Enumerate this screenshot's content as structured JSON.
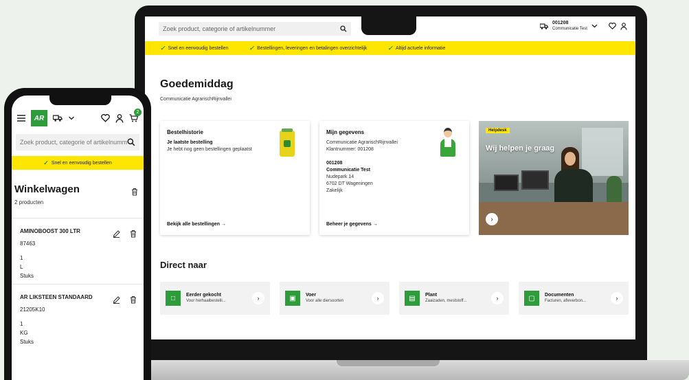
{
  "desktop": {
    "search_placeholder": "Zoek product, categorie of artikelnummer",
    "account": {
      "number": "001208",
      "name": "Communicatie Test"
    },
    "usps": [
      "Snel en eenvoudig bestellen",
      "Bestellingen, leveringen en betalingen overzichtelijk",
      "Altijd actuele informatie"
    ],
    "greeting": "Goedemiddag",
    "subtitle": "Communicatie AgrarischRijnvallei",
    "order_card": {
      "title": "Bestelhistorie",
      "subtitle": "Je laatste bestelling",
      "text": "Je hebt nog geen bestellingen geplaatst",
      "link": "Bekijk alle bestellingen →"
    },
    "data_card": {
      "title": "Mijn gegevens",
      "lines": [
        "Communicatie AgrarischRijnvallei",
        "Klantnummer: 001208"
      ],
      "address": [
        "001208",
        "Communicatie Test",
        "Nudepark 14",
        "6702 DT Wageningen",
        "Zakelijk"
      ],
      "link": "Beheer je gegevens →"
    },
    "promo": {
      "tag": "Helpdesk",
      "title": "Wij helpen je graag",
      "arrow": "›"
    },
    "direct_title": "Direct naar",
    "tiles": [
      {
        "title": "Eerder gekocht",
        "desc": "Voor herhaalbestelli...",
        "icon": "□"
      },
      {
        "title": "Voer",
        "desc": "Voor alle diersoorten",
        "icon": "▣"
      },
      {
        "title": "Plant",
        "desc": "Zaaizaden, meststoff...",
        "icon": "▤"
      },
      {
        "title": "Documenten",
        "desc": "Facturen, afleverbon...",
        "icon": "▢"
      }
    ]
  },
  "mobile": {
    "logo": "AR",
    "cart_count": "2",
    "search_placeholder": "Zoek product, categorie of artikelnummer",
    "usp": "Snel en eenvoudig bestellen",
    "title": "Winkelwagen",
    "count": "2 producten",
    "items": [
      {
        "name": "AMINOBOOST 300 LTR",
        "sku": "87463",
        "qty": "1",
        "unit": "L",
        "pack": "Stuks"
      },
      {
        "name": "AR LIKSTEEN STANDAARD",
        "sku": "21205K10",
        "qty": "1",
        "unit": "KG",
        "pack": "Stuks"
      }
    ]
  },
  "colors": {
    "brand_green": "#2e9c3a",
    "accent_yellow": "#ffe600"
  }
}
